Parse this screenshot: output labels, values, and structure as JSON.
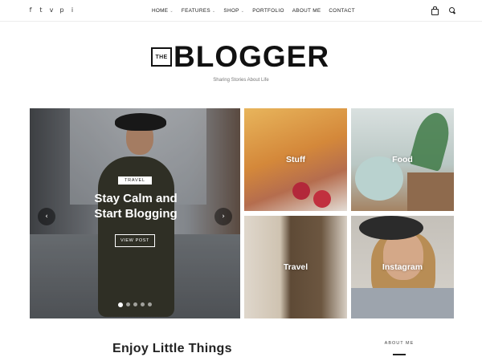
{
  "social": {
    "facebook": "f",
    "twitter": "t",
    "vimeo": "v",
    "pinterest": "p",
    "instagram": "i"
  },
  "nav": {
    "items": [
      {
        "label": "HOME",
        "caret": "⌄"
      },
      {
        "label": "FEATURES",
        "caret": "⌄"
      },
      {
        "label": "SHOP",
        "caret": "⌄"
      },
      {
        "label": "PORTFOLIO"
      },
      {
        "label": "ABOUT ME"
      },
      {
        "label": "CONTACT"
      }
    ]
  },
  "icons": {
    "cart": "cart-icon",
    "search": "search-icon",
    "prev": "‹",
    "next": "›"
  },
  "logo": {
    "the": "THE",
    "word": "BLOGGER",
    "tagline": "Sharing Stories About Life"
  },
  "slider": {
    "category": "TRAVEL",
    "title_line1": "Stay Calm and",
    "title_line2": "Start Blogging",
    "button": "VIEW POST",
    "dots": 5,
    "active_dot": 1
  },
  "categories": [
    {
      "label": "Stuff"
    },
    {
      "label": "Food"
    },
    {
      "label": "Travel"
    },
    {
      "label": "Instagram"
    }
  ],
  "main": {
    "heading": "Enjoy Little Things"
  },
  "sidebar": {
    "about_heading": "ABOUT ME"
  }
}
